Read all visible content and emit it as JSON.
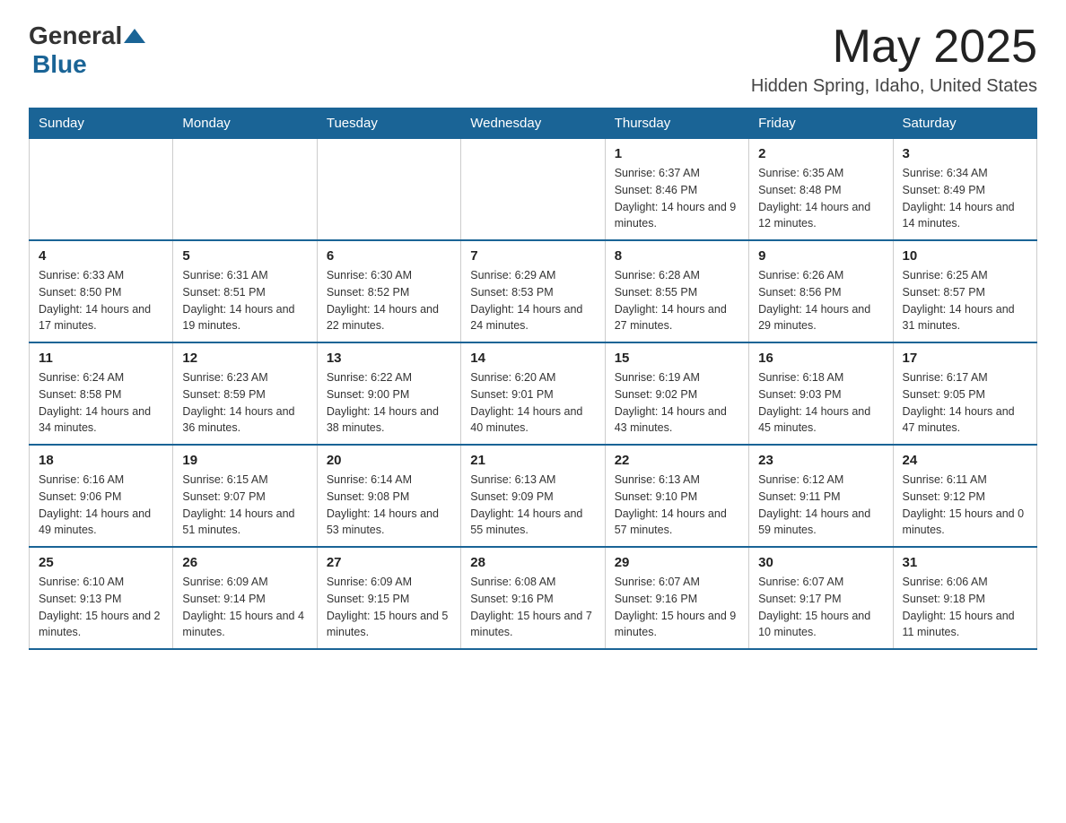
{
  "logo": {
    "general": "General",
    "blue": "Blue"
  },
  "title": {
    "month_year": "May 2025",
    "location": "Hidden Spring, Idaho, United States"
  },
  "header": {
    "days": [
      "Sunday",
      "Monday",
      "Tuesday",
      "Wednesday",
      "Thursday",
      "Friday",
      "Saturday"
    ]
  },
  "weeks": [
    {
      "days": [
        {
          "number": "",
          "info": ""
        },
        {
          "number": "",
          "info": ""
        },
        {
          "number": "",
          "info": ""
        },
        {
          "number": "",
          "info": ""
        },
        {
          "number": "1",
          "info": "Sunrise: 6:37 AM\nSunset: 8:46 PM\nDaylight: 14 hours and 9 minutes."
        },
        {
          "number": "2",
          "info": "Sunrise: 6:35 AM\nSunset: 8:48 PM\nDaylight: 14 hours and 12 minutes."
        },
        {
          "number": "3",
          "info": "Sunrise: 6:34 AM\nSunset: 8:49 PM\nDaylight: 14 hours and 14 minutes."
        }
      ]
    },
    {
      "days": [
        {
          "number": "4",
          "info": "Sunrise: 6:33 AM\nSunset: 8:50 PM\nDaylight: 14 hours and 17 minutes."
        },
        {
          "number": "5",
          "info": "Sunrise: 6:31 AM\nSunset: 8:51 PM\nDaylight: 14 hours and 19 minutes."
        },
        {
          "number": "6",
          "info": "Sunrise: 6:30 AM\nSunset: 8:52 PM\nDaylight: 14 hours and 22 minutes."
        },
        {
          "number": "7",
          "info": "Sunrise: 6:29 AM\nSunset: 8:53 PM\nDaylight: 14 hours and 24 minutes."
        },
        {
          "number": "8",
          "info": "Sunrise: 6:28 AM\nSunset: 8:55 PM\nDaylight: 14 hours and 27 minutes."
        },
        {
          "number": "9",
          "info": "Sunrise: 6:26 AM\nSunset: 8:56 PM\nDaylight: 14 hours and 29 minutes."
        },
        {
          "number": "10",
          "info": "Sunrise: 6:25 AM\nSunset: 8:57 PM\nDaylight: 14 hours and 31 minutes."
        }
      ]
    },
    {
      "days": [
        {
          "number": "11",
          "info": "Sunrise: 6:24 AM\nSunset: 8:58 PM\nDaylight: 14 hours and 34 minutes."
        },
        {
          "number": "12",
          "info": "Sunrise: 6:23 AM\nSunset: 8:59 PM\nDaylight: 14 hours and 36 minutes."
        },
        {
          "number": "13",
          "info": "Sunrise: 6:22 AM\nSunset: 9:00 PM\nDaylight: 14 hours and 38 minutes."
        },
        {
          "number": "14",
          "info": "Sunrise: 6:20 AM\nSunset: 9:01 PM\nDaylight: 14 hours and 40 minutes."
        },
        {
          "number": "15",
          "info": "Sunrise: 6:19 AM\nSunset: 9:02 PM\nDaylight: 14 hours and 43 minutes."
        },
        {
          "number": "16",
          "info": "Sunrise: 6:18 AM\nSunset: 9:03 PM\nDaylight: 14 hours and 45 minutes."
        },
        {
          "number": "17",
          "info": "Sunrise: 6:17 AM\nSunset: 9:05 PM\nDaylight: 14 hours and 47 minutes."
        }
      ]
    },
    {
      "days": [
        {
          "number": "18",
          "info": "Sunrise: 6:16 AM\nSunset: 9:06 PM\nDaylight: 14 hours and 49 minutes."
        },
        {
          "number": "19",
          "info": "Sunrise: 6:15 AM\nSunset: 9:07 PM\nDaylight: 14 hours and 51 minutes."
        },
        {
          "number": "20",
          "info": "Sunrise: 6:14 AM\nSunset: 9:08 PM\nDaylight: 14 hours and 53 minutes."
        },
        {
          "number": "21",
          "info": "Sunrise: 6:13 AM\nSunset: 9:09 PM\nDaylight: 14 hours and 55 minutes."
        },
        {
          "number": "22",
          "info": "Sunrise: 6:13 AM\nSunset: 9:10 PM\nDaylight: 14 hours and 57 minutes."
        },
        {
          "number": "23",
          "info": "Sunrise: 6:12 AM\nSunset: 9:11 PM\nDaylight: 14 hours and 59 minutes."
        },
        {
          "number": "24",
          "info": "Sunrise: 6:11 AM\nSunset: 9:12 PM\nDaylight: 15 hours and 0 minutes."
        }
      ]
    },
    {
      "days": [
        {
          "number": "25",
          "info": "Sunrise: 6:10 AM\nSunset: 9:13 PM\nDaylight: 15 hours and 2 minutes."
        },
        {
          "number": "26",
          "info": "Sunrise: 6:09 AM\nSunset: 9:14 PM\nDaylight: 15 hours and 4 minutes."
        },
        {
          "number": "27",
          "info": "Sunrise: 6:09 AM\nSunset: 9:15 PM\nDaylight: 15 hours and 5 minutes."
        },
        {
          "number": "28",
          "info": "Sunrise: 6:08 AM\nSunset: 9:16 PM\nDaylight: 15 hours and 7 minutes."
        },
        {
          "number": "29",
          "info": "Sunrise: 6:07 AM\nSunset: 9:16 PM\nDaylight: 15 hours and 9 minutes."
        },
        {
          "number": "30",
          "info": "Sunrise: 6:07 AM\nSunset: 9:17 PM\nDaylight: 15 hours and 10 minutes."
        },
        {
          "number": "31",
          "info": "Sunrise: 6:06 AM\nSunset: 9:18 PM\nDaylight: 15 hours and 11 minutes."
        }
      ]
    }
  ]
}
